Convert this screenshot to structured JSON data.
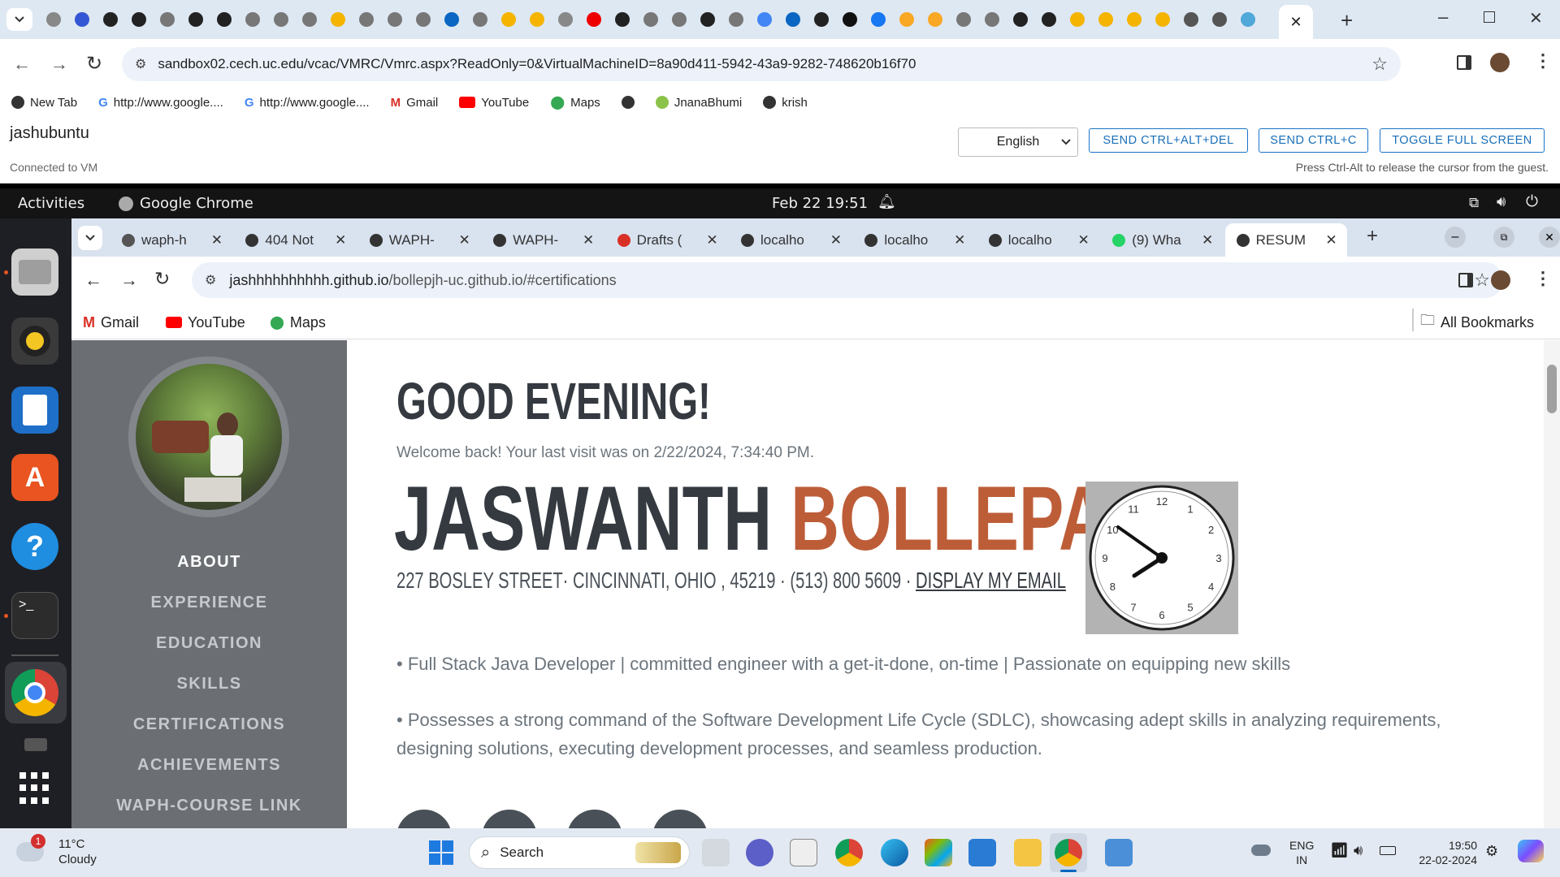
{
  "outer_browser": {
    "url": "sandbox02.cech.uc.edu/vcac/VMRC/Vmrc.aspx?ReadOnly=0&VirtualMachineID=8a90d411-5942-43a9-9282-748620b16f70",
    "bookmarks": [
      "New Tab",
      "http://www.google....",
      "http://www.google....",
      "Gmail",
      "YouTube",
      "Maps",
      "",
      "JnanaBhumi",
      "krish"
    ]
  },
  "vmrc": {
    "vm_name": "jashubuntu",
    "status": "Connected to VM",
    "language": "English",
    "btn_ctrl_alt_del": "SEND CTRL+ALT+DEL",
    "btn_ctrl_c": "SEND CTRL+C",
    "btn_fullscreen": "TOGGLE FULL SCREEN",
    "hint": "Press Ctrl-Alt to release the cursor from the guest."
  },
  "gnome": {
    "activities": "Activities",
    "app": "Google Chrome",
    "datetime": "Feb 22  19:51"
  },
  "inner_browser": {
    "tabs": [
      "waph-h",
      "404 Not",
      "WAPH-",
      "WAPH-",
      "Drafts (",
      "localho",
      "localho",
      "localho",
      "(9) Wha",
      "RESUM"
    ],
    "url_host": "jashhhhhhhhhh.github.io",
    "url_path": "/bollepjh-uc.github.io/#certifications",
    "bookmarks": [
      "Gmail",
      "YouTube",
      "Maps"
    ],
    "all_bookmarks": "All Bookmarks"
  },
  "sidebar": {
    "nav": [
      "ABOUT",
      "EXPERIENCE",
      "EDUCATION",
      "SKILLS",
      "CERTIFICATIONS",
      "ACHIEVEMENTS",
      "WAPH-COURSE LINK"
    ]
  },
  "page": {
    "greeting": "GOOD EVENING!",
    "welcome": "Welcome back! Your last visit was on 2/22/2024, 7:34:40 PM.",
    "first_name": "JASWANTH",
    "last_name": "BOLLEPALLI",
    "address": "227 BOSLEY STREET· CINCINNATI, OHIO , 45219 · (513) 800 5609 · ",
    "email_link": "DISPLAY MY EMAIL",
    "bullet1": "• Full Stack Java Developer | committed engineer with a get-it-done, on-time | Passionate on equipping new skills",
    "bullet2": "• Possesses a strong command of the Software Development Life Cycle (SDLC), showcasing adept skills in analyzing requirements, designing solutions, executing development processes, and seamless production.",
    "clock_numbers": [
      "12",
      "1",
      "2",
      "3",
      "4",
      "5",
      "6",
      "7",
      "8",
      "9",
      "10",
      "11"
    ],
    "accent_color": "#bd5d38"
  },
  "taskbar": {
    "weather_temp": "11°C",
    "weather_desc": "Cloudy",
    "weather_badge": "1",
    "search": "Search",
    "lang1": "ENG",
    "lang2": "IN",
    "time": "19:50",
    "date": "22-02-2024"
  }
}
